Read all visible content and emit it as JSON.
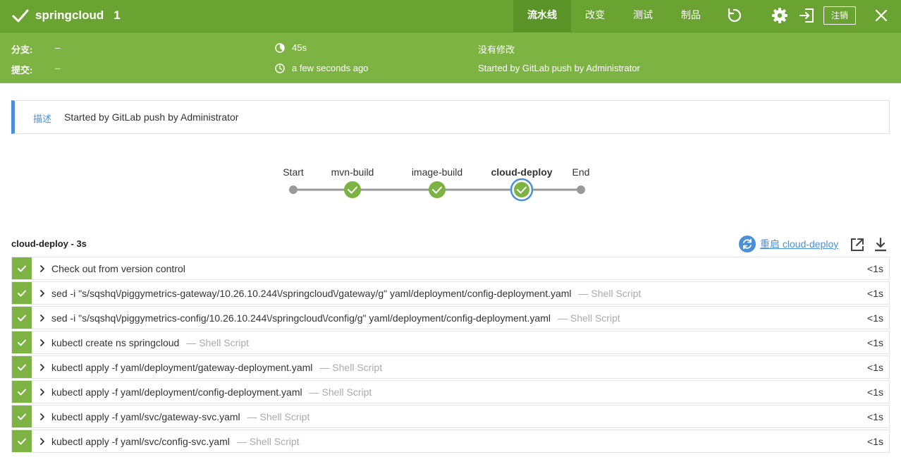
{
  "header": {
    "title": "springcloud",
    "run_number": "1",
    "tabs": [
      {
        "label": "流水线",
        "active": true
      },
      {
        "label": "改变",
        "active": false
      },
      {
        "label": "测试",
        "active": false
      },
      {
        "label": "制品",
        "active": false
      }
    ],
    "logout_label": "注销",
    "icons": [
      "replay-icon",
      "gear-icon",
      "exit-icon",
      "close-icon"
    ]
  },
  "summary": {
    "branch_label": "分支:",
    "branch_value": "–",
    "commit_label": "提交:",
    "commit_value": "–",
    "duration": "45s",
    "time_ago": "a few seconds ago",
    "changes": "没有修改",
    "cause": "Started by GitLab push by Administrator"
  },
  "description": {
    "label": "描述",
    "text": "Started by GitLab push by Administrator"
  },
  "pipeline": {
    "stages": [
      {
        "label": "Start",
        "kind": "endpoint"
      },
      {
        "label": "mvn-build",
        "kind": "success"
      },
      {
        "label": "image-build",
        "kind": "success"
      },
      {
        "label": "cloud-deploy",
        "kind": "success",
        "selected": true
      },
      {
        "label": "End",
        "kind": "endpoint"
      }
    ]
  },
  "steps_panel": {
    "title": "cloud-deploy - 3s",
    "restart_label": "重启 cloud-deploy",
    "steps": [
      {
        "text": "Check out from version control",
        "sub": "",
        "duration": "<1s"
      },
      {
        "text": "sed -i \"s/sqshq\\/piggymetrics-gateway/10.26.10.244\\/springcloud\\/gateway/g\" yaml/deployment/config-deployment.yaml",
        "sub": "— Shell Script",
        "duration": "<1s"
      },
      {
        "text": "sed -i \"s/sqshq\\/piggymetrics-config/10.26.10.244\\/springcloud\\/config/g\" yaml/deployment/config-deployment.yaml",
        "sub": "— Shell Script",
        "duration": "<1s"
      },
      {
        "text": "kubectl create ns springcloud",
        "sub": "— Shell Script",
        "duration": "<1s"
      },
      {
        "text": "kubectl apply -f yaml/deployment/gateway-deployment.yaml",
        "sub": "— Shell Script",
        "duration": "<1s"
      },
      {
        "text": "kubectl apply -f yaml/deployment/config-deployment.yaml",
        "sub": "— Shell Script",
        "duration": "<1s"
      },
      {
        "text": "kubectl apply -f yaml/svc/gateway-svc.yaml",
        "sub": "— Shell Script",
        "duration": "<1s"
      },
      {
        "text": "kubectl apply -f yaml/svc/config-svc.yaml",
        "sub": "— Shell Script",
        "duration": "<1s"
      }
    ]
  },
  "colors": {
    "header_green": "#6aa332",
    "summary_green": "#7cb342",
    "success_green": "#7cb342",
    "selected_blue": "#4a90d9",
    "track_gray": "#999999"
  }
}
